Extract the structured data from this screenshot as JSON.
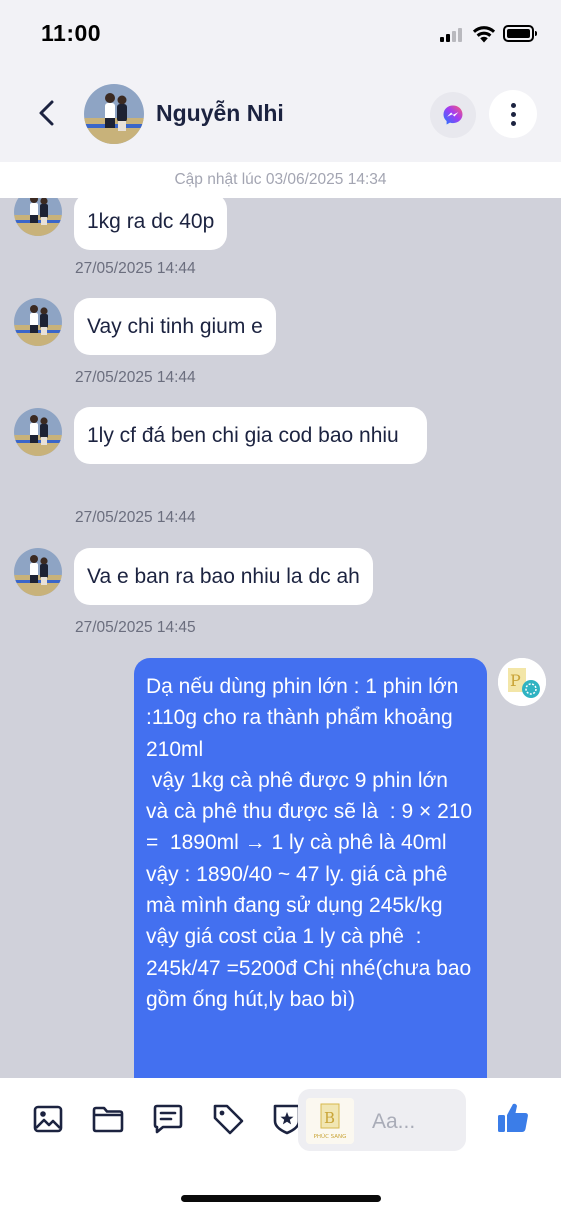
{
  "status_bar": {
    "time": "11:00"
  },
  "header": {
    "contact_name": "Nguyễn Nhi"
  },
  "updated_label": "Cập nhật lúc 03/06/2025 14:34",
  "messages": [
    {
      "text": "1kg ra dc 40p",
      "time": "27/05/2025 14:44"
    },
    {
      "text": "Vay chi tinh gium e",
      "time": "27/05/2025 14:44"
    },
    {
      "text": "1ly cf đá ben chi gia cod bao nhiu",
      "time": "27/05/2025 14:44"
    },
    {
      "text": "Va e ban ra bao nhiu la dc ah",
      "time": "27/05/2025 14:45"
    }
  ],
  "outgoing": {
    "text": "Dạ nếu dùng phin lớn : 1 phin lớn :110g cho ra thành phẩm khoảng 210ml\n vậy 1kg cà phê được 9 phin lớn  và cà phê thu được sẽ là  : 9 × 210 =  1890ml → 1 ly cà phê là 40ml  vậy : 1890/40 ~ 47 ly. giá cà phê mà mình đang sử dụng 245k/kg vậy giá cost của 1 ly cà phê  : 245k/47 =5200đ Chị nhé(chưa bao gồm ống hút,ly bao bì)"
  },
  "composer": {
    "placeholder": "Aa...",
    "thumb_caption": "PHÚC SANG"
  },
  "colors": {
    "accent": "#4370f0",
    "chat_bg": "#d0d1da",
    "header_bg": "#f2f2f6"
  },
  "icons": [
    "back-chevron-icon",
    "messenger-icon",
    "more-vertical-icon",
    "image-icon",
    "folder-icon",
    "message-template-icon",
    "tag-icon",
    "badge-star-icon",
    "thumbs-up-icon"
  ]
}
